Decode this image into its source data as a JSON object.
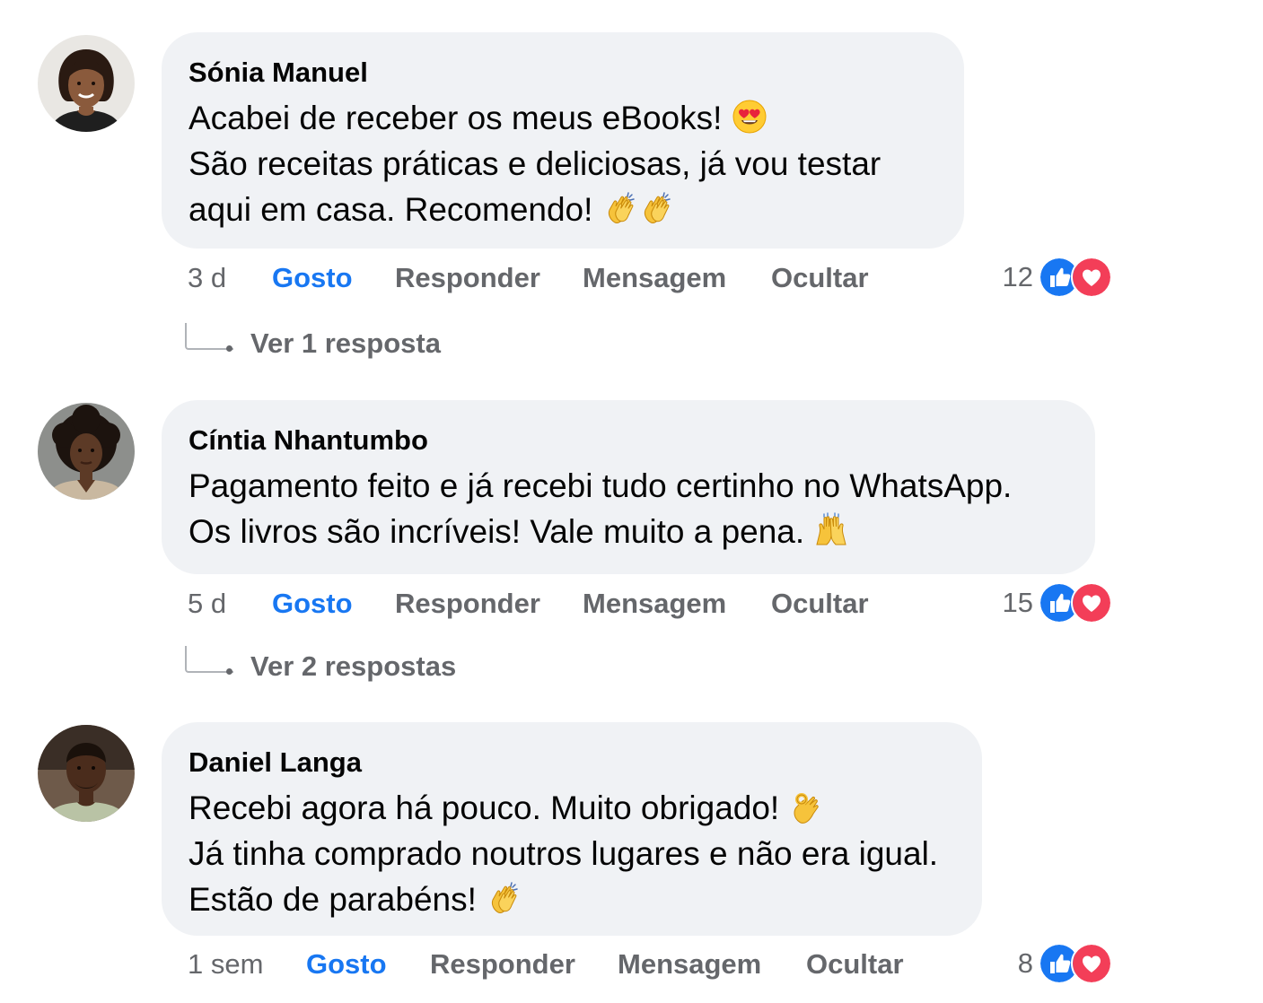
{
  "comments": [
    {
      "author": "Sónia Manuel",
      "lines": [
        "Acabei de receber os meus eBooks!",
        "São receitas práticas e deliciosas, já vou testar",
        "aqui em casa. Recomendo!"
      ],
      "emojis": [
        "heart-eyes",
        "clap",
        "clap"
      ],
      "time": "3 d",
      "reaction_count": "12",
      "replies_label": "Ver 1 resposta"
    },
    {
      "author": "Cíntia Nhantumbo",
      "lines": [
        "Pagamento feito e já recebi tudo certinho no WhatsApp.",
        "Os livros são incríveis! Vale muito a pena."
      ],
      "emojis": [
        "raised-hands"
      ],
      "time": "5 d",
      "reaction_count": "15",
      "replies_label": "Ver 2 respostas"
    },
    {
      "author": "Daniel Langa",
      "lines": [
        "Recebi agora há pouco. Muito obrigado!",
        "Já tinha comprado noutros lugares e não era igual.",
        "Estão de parabéns!"
      ],
      "emojis": [
        "ok-hand",
        "clap"
      ],
      "time": "1 sem",
      "reaction_count": "8"
    }
  ],
  "actions": {
    "like": "Gosto",
    "reply": "Responder",
    "message": "Mensagem",
    "hide": "Ocultar"
  },
  "colors": {
    "bubble": "#f0f2f5",
    "like_blue": "#1877f2",
    "love_red": "#f33e58",
    "secondary_text": "#65676b"
  }
}
